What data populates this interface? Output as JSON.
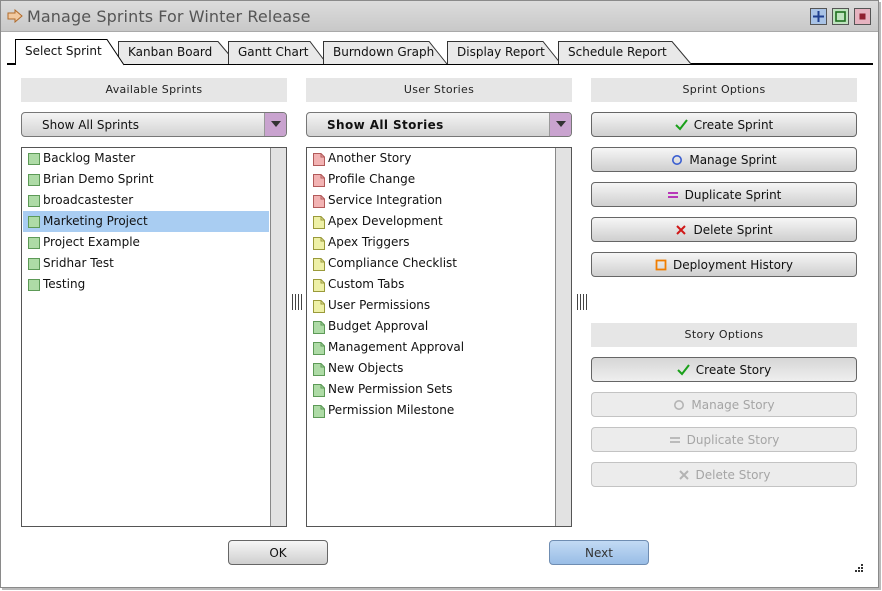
{
  "window": {
    "title": "Manage Sprints For Winter Release",
    "controls": [
      "maximize-icon",
      "restore-icon",
      "close-icon"
    ]
  },
  "tabs": [
    {
      "label": "Select Sprint",
      "active": true
    },
    {
      "label": "Kanban Board",
      "active": false
    },
    {
      "label": "Gantt Chart",
      "active": false
    },
    {
      "label": "Burndown Graph",
      "active": false
    },
    {
      "label": "Display Report",
      "active": false
    },
    {
      "label": "Schedule Report",
      "active": false
    }
  ],
  "sprints_panel": {
    "header": "Available Sprints",
    "filter": "Show All Sprints",
    "items": [
      {
        "label": "Backlog Master",
        "selected": false
      },
      {
        "label": "Brian Demo Sprint",
        "selected": false
      },
      {
        "label": "broadcastester",
        "selected": false
      },
      {
        "label": "Marketing Project",
        "selected": true
      },
      {
        "label": "Project Example",
        "selected": false
      },
      {
        "label": "Sridhar Test",
        "selected": false
      },
      {
        "label": "Testing",
        "selected": false
      }
    ]
  },
  "stories_panel": {
    "header": "User Stories",
    "filter": "Show All Stories",
    "items": [
      {
        "label": "Another Story",
        "status": "red"
      },
      {
        "label": "Profile Change",
        "status": "red"
      },
      {
        "label": "Service Integration",
        "status": "red"
      },
      {
        "label": "Apex Development",
        "status": "yellow"
      },
      {
        "label": "Apex Triggers",
        "status": "yellow"
      },
      {
        "label": "Compliance Checklist",
        "status": "yellow"
      },
      {
        "label": "Custom Tabs",
        "status": "yellow"
      },
      {
        "label": "User Permissions",
        "status": "yellow"
      },
      {
        "label": "Budget Approval",
        "status": "green"
      },
      {
        "label": "Management Approval",
        "status": "green"
      },
      {
        "label": "New Objects",
        "status": "green"
      },
      {
        "label": "New Permission Sets",
        "status": "green"
      },
      {
        "label": "Permission Milestone",
        "status": "green"
      }
    ]
  },
  "sprint_options": {
    "header": "Sprint Options",
    "buttons": [
      {
        "label": "Create Sprint",
        "icon": "check-icon",
        "enabled": true
      },
      {
        "label": "Manage Sprint",
        "icon": "circle-icon",
        "enabled": true
      },
      {
        "label": "Duplicate Sprint",
        "icon": "equals-icon",
        "enabled": true
      },
      {
        "label": "Delete Sprint",
        "icon": "x-icon",
        "enabled": true
      },
      {
        "label": "Deployment History",
        "icon": "square-icon",
        "enabled": true
      }
    ]
  },
  "story_options": {
    "header": "Story Options",
    "buttons": [
      {
        "label": "Create Story",
        "icon": "check-icon",
        "enabled": true
      },
      {
        "label": "Manage Story",
        "icon": "circle-icon",
        "enabled": false
      },
      {
        "label": "Duplicate Story",
        "icon": "equals-icon",
        "enabled": false
      },
      {
        "label": "Delete Story",
        "icon": "x-icon",
        "enabled": false
      }
    ]
  },
  "footer": {
    "ok_label": "OK",
    "next_label": "Next"
  },
  "colors": {
    "selection": "#a9cdf2",
    "dropdown_arrow": "#c9a3cf",
    "next_button": "#a9c9ee",
    "story_red": "#f2b3b3",
    "story_yellow": "#eef0a6",
    "story_green": "#aedba6",
    "check": "#1aa01a",
    "circle": "#3a5ed0",
    "equals": "#b21fb2",
    "x": "#d01818",
    "square": "#f07d00"
  }
}
